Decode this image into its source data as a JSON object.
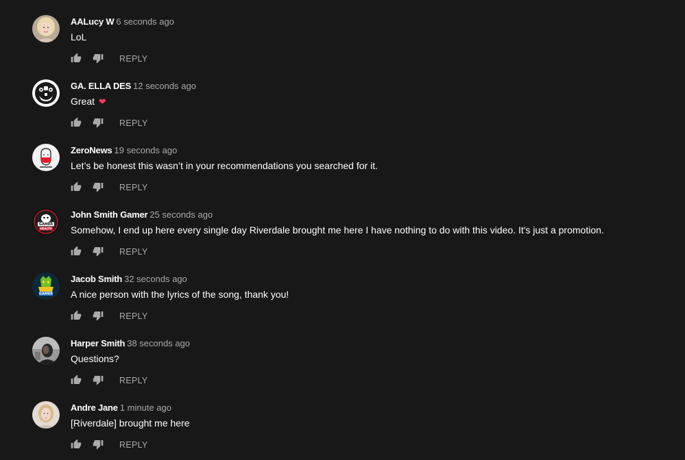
{
  "comments": [
    {
      "author": "AALucy W",
      "time": "6 seconds ago",
      "text": "LoL",
      "reply_label": "REPLY",
      "avatar": "woman-portrait-blonde",
      "avatar_bg": "#c9b8a8"
    },
    {
      "author": "GA. ELLA DES",
      "time": "12 seconds ago",
      "text": "Great",
      "heart": "❤",
      "reply_label": "REPLY",
      "avatar": "robot-logo",
      "avatar_bg": "#ffffff"
    },
    {
      "author": "ZeroNews",
      "time": "19 seconds ago",
      "text": "Let’s be honest this wasn’t in your recommendations you searched for it.",
      "reply_label": "REPLY",
      "avatar": "masked-face-logo",
      "avatar_bg": "#f2f2f2"
    },
    {
      "author": "John Smith Gamer",
      "time": "25 seconds ago",
      "text": "Somehow, I end up here every single day Riverdale brought me here I have nothing to do with this video. It's just a promotion.",
      "reply_label": "REPLY",
      "avatar": "gamer-health-logo",
      "avatar_bg": "#111111"
    },
    {
      "author": "Jacob Smith",
      "time": "32 seconds ago",
      "text": "A nice person with the lyrics of the song, thank you!",
      "reply_label": "REPLY",
      "avatar": "gamer-mascot-logo",
      "avatar_bg": "#0c2a3a"
    },
    {
      "author": "Harper Smith",
      "time": "38 seconds ago",
      "text": "Questions?",
      "reply_label": "REPLY",
      "avatar": "man-portrait-dark",
      "avatar_bg": "#8a8a8a"
    },
    {
      "author": "Andre Jane",
      "time": "1 minute ago",
      "text": "[Riverdale] brought me here",
      "reply_label": "REPLY",
      "avatar": "woman-portrait-light",
      "avatar_bg": "#d9cfc6"
    }
  ],
  "avatar_badges": {
    "gamer_health_top": "GAMER",
    "gamer_health_bottom": "HEALTH",
    "gamer_mascot": "GAMER"
  },
  "colors": {
    "background": "#181818",
    "author": "#ffffff",
    "timestamp": "#aaaaaa",
    "action_icon": "#aaaaaa"
  }
}
